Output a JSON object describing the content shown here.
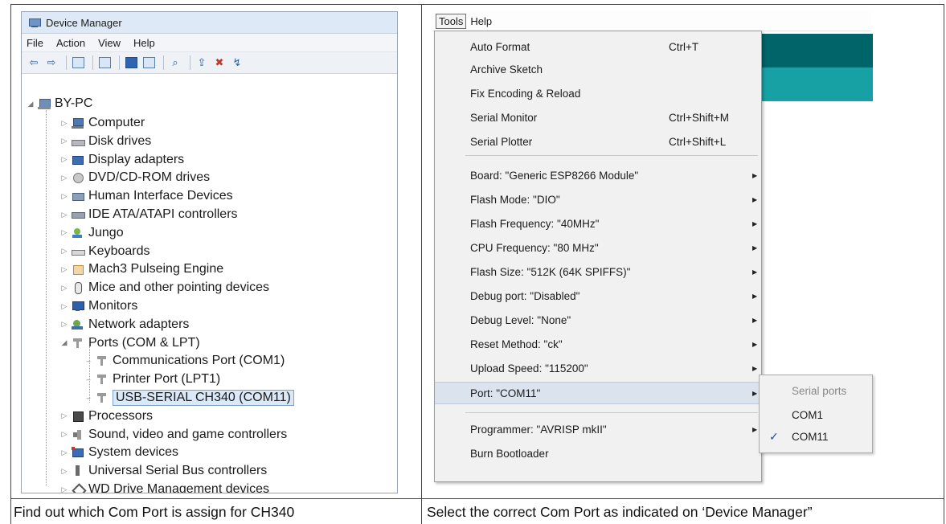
{
  "device_manager": {
    "title": "Device Manager",
    "menu": [
      "File",
      "Action",
      "View",
      "Help"
    ],
    "root": "BY-PC",
    "items": [
      {
        "label": "Computer",
        "icon": "computer-icon"
      },
      {
        "label": "Disk drives",
        "icon": "disk-drive-icon"
      },
      {
        "label": "Display adapters",
        "icon": "display-adapter-icon"
      },
      {
        "label": "DVD/CD-ROM drives",
        "icon": "dvd-drive-icon"
      },
      {
        "label": "Human Interface Devices",
        "icon": "hid-icon"
      },
      {
        "label": "IDE ATA/ATAPI controllers",
        "icon": "ide-controller-icon"
      },
      {
        "label": "Jungo",
        "icon": "jungo-icon"
      },
      {
        "label": "Keyboards",
        "icon": "keyboard-icon"
      },
      {
        "label": "Mach3 Pulseing Engine",
        "icon": "mach3-icon"
      },
      {
        "label": "Mice and other pointing devices",
        "icon": "mouse-icon"
      },
      {
        "label": "Monitors",
        "icon": "monitor-icon"
      },
      {
        "label": "Network adapters",
        "icon": "network-adapter-icon"
      },
      {
        "label": "Ports (COM & LPT)",
        "icon": "port-icon",
        "expanded": true
      },
      {
        "label": "Communications Port (COM1)",
        "icon": "port-icon",
        "child": true
      },
      {
        "label": "Printer Port (LPT1)",
        "icon": "port-icon",
        "child": true
      },
      {
        "label": "USB-SERIAL CH340 (COM11)",
        "icon": "port-icon",
        "child": true,
        "selected": true
      },
      {
        "label": "Processors",
        "icon": "processor-icon"
      },
      {
        "label": "Sound, video and game controllers",
        "icon": "speaker-icon"
      },
      {
        "label": "System devices",
        "icon": "system-device-icon"
      },
      {
        "label": "Universal Serial Bus controllers",
        "icon": "usb-icon"
      },
      {
        "label": "WD Drive Management devices",
        "icon": "wd-drive-icon"
      }
    ]
  },
  "ide": {
    "menubar": {
      "tools": "Tools",
      "help": "Help"
    },
    "tools_menu": [
      {
        "label": "Auto Format",
        "shortcut": "Ctrl+T"
      },
      {
        "label": "Archive Sketch",
        "shortcut": ""
      },
      {
        "label": "Fix Encoding & Reload",
        "shortcut": ""
      },
      {
        "label": "Serial Monitor",
        "shortcut": "Ctrl+Shift+M"
      },
      {
        "label": "Serial Plotter",
        "shortcut": "Ctrl+Shift+L"
      },
      {
        "label": "Board: \"Generic ESP8266 Module\"",
        "submenu": true
      },
      {
        "label": "Flash Mode: \"DIO\"",
        "submenu": true
      },
      {
        "label": "Flash Frequency: \"40MHz\"",
        "submenu": true
      },
      {
        "label": "CPU Frequency: \"80 MHz\"",
        "submenu": true
      },
      {
        "label": "Flash Size: \"512K (64K SPIFFS)\"",
        "submenu": true
      },
      {
        "label": "Debug port: \"Disabled\"",
        "submenu": true
      },
      {
        "label": "Debug Level: \"None\"",
        "submenu": true
      },
      {
        "label": "Reset Method: \"ck\"",
        "submenu": true
      },
      {
        "label": "Upload Speed: \"115200\"",
        "submenu": true
      },
      {
        "label": "Port: \"COM11\"",
        "submenu": true,
        "highlighted": true
      },
      {
        "label": "Programmer: \"AVRISP mkII\"",
        "submenu": true
      },
      {
        "label": "Burn Bootloader",
        "shortcut": ""
      }
    ],
    "port_submenu": {
      "header": "Serial ports",
      "options": [
        {
          "label": "COM1",
          "checked": false
        },
        {
          "label": "COM11",
          "checked": true
        }
      ],
      "check_mark": "✓"
    }
  },
  "captions": {
    "left": "Find out which Com Port is assign for CH340",
    "right": "Select the correct Com Port as indicated on ‘Device Manager”"
  },
  "colors": {
    "teal_dark": "#006468",
    "teal_light": "#17a1a5",
    "menu_highlight": "#dbe3ee"
  }
}
